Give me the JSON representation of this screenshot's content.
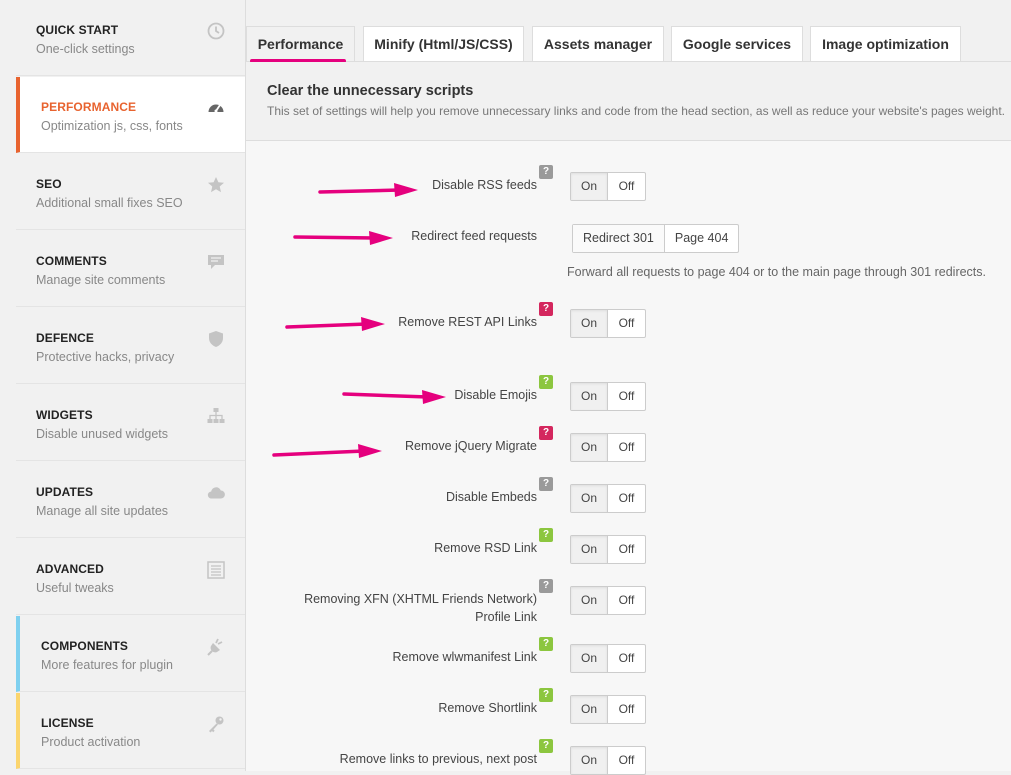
{
  "sidebar": {
    "items": [
      {
        "title": "QUICK START",
        "subtitle": "One-click settings",
        "icon": "clock-icon"
      },
      {
        "title": "PERFORMANCE",
        "subtitle": "Optimization js, css, fonts",
        "icon": "dashboard-icon"
      },
      {
        "title": "SEO",
        "subtitle": "Additional small fixes SEO",
        "icon": "star-icon"
      },
      {
        "title": "COMMENTS",
        "subtitle": "Manage site comments",
        "icon": "comment-icon"
      },
      {
        "title": "DEFENCE",
        "subtitle": "Protective hacks, privacy",
        "icon": "shield-icon"
      },
      {
        "title": "WIDGETS",
        "subtitle": "Disable unused widgets",
        "icon": "sitemap-icon"
      },
      {
        "title": "UPDATES",
        "subtitle": "Manage all site updates",
        "icon": "cloud-icon"
      },
      {
        "title": "ADVANCED",
        "subtitle": "Useful tweaks",
        "icon": "list-icon"
      },
      {
        "title": "COMPONENTS",
        "subtitle": "More features for plugin",
        "icon": "plug-icon"
      },
      {
        "title": "LICENSE",
        "subtitle": "Product activation",
        "icon": "key-icon"
      }
    ]
  },
  "tabs": [
    {
      "label": "Performance"
    },
    {
      "label": "Minify (Html/JS/CSS)"
    },
    {
      "label": "Assets manager"
    },
    {
      "label": "Google services"
    },
    {
      "label": "Image optimization"
    }
  ],
  "section": {
    "title": "Clear the unnecessary scripts",
    "description": "This set of settings will help you remove unnecessary links and code from the head section, as well as reduce your website's pages weight."
  },
  "toggle_labels": {
    "on": "On",
    "off": "Off"
  },
  "help_mark": "?",
  "colors": {
    "accent_orange": "#e8632f",
    "annotation_pink": "#e5007e",
    "help_gray": "#9a9a9a",
    "help_red": "#d4275e",
    "help_green": "#8cc63f"
  },
  "settings": [
    {
      "label": "Disable RSS feeds",
      "help": "gray",
      "state": "On"
    },
    {
      "label": "Redirect feed requests",
      "options": [
        "Redirect 301",
        "Page 404"
      ],
      "selected": "Redirect 301",
      "hint": "Forward all requests to page 404 or to the main page through 301 redirects."
    },
    {
      "label": "Remove REST API Links",
      "help": "red",
      "state": "On"
    },
    {
      "label": "Disable Emojis",
      "help": "green",
      "state": "On"
    },
    {
      "label": "Remove jQuery Migrate",
      "help": "red",
      "state": "On"
    },
    {
      "label": "Disable Embeds",
      "help": "gray",
      "state": "On"
    },
    {
      "label": "Remove RSD Link",
      "help": "green",
      "state": "On"
    },
    {
      "label_line1": "Removing XFN (XHTML Friends Network)",
      "label_line2": "Profile Link",
      "help": "gray",
      "state": "On"
    },
    {
      "label": "Remove wlwmanifest Link",
      "help": "green",
      "state": "On"
    },
    {
      "label": "Remove Shortlink",
      "help": "green",
      "state": "On"
    },
    {
      "label": "Remove links to previous, next post",
      "help": "green",
      "state": "On"
    }
  ]
}
